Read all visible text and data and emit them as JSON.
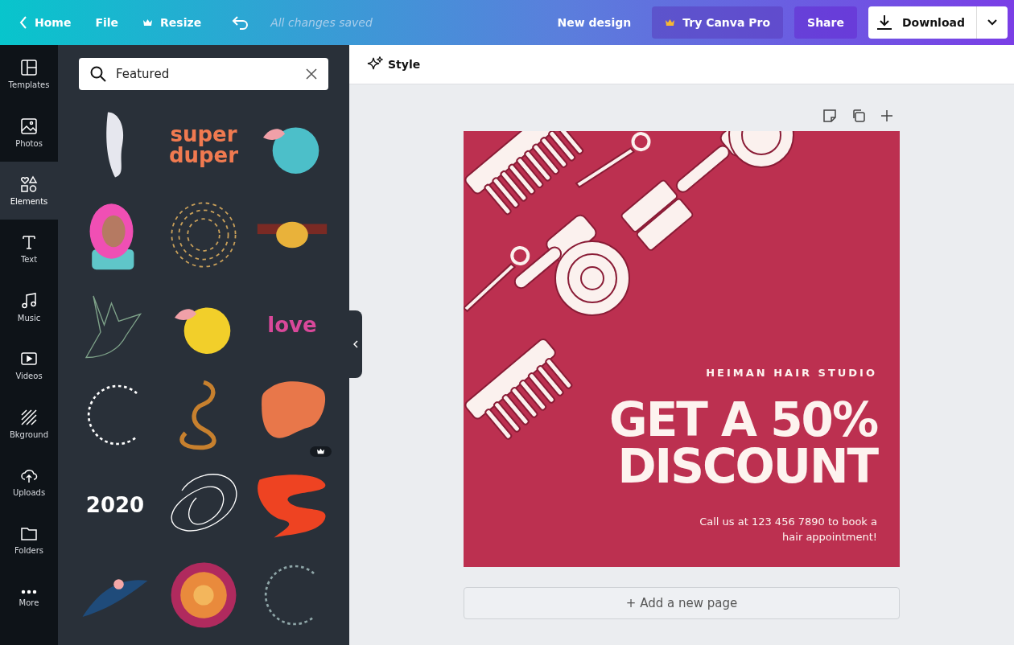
{
  "topbar": {
    "home": "Home",
    "file": "File",
    "resize": "Resize",
    "status": "All changes saved",
    "new_design": "New design",
    "try_pro": "Try Canva Pro",
    "share": "Share",
    "download": "Download"
  },
  "sidebar": {
    "items": [
      {
        "label": "Templates",
        "kind": "templates",
        "selected": false
      },
      {
        "label": "Photos",
        "kind": "photos",
        "selected": false
      },
      {
        "label": "Elements",
        "kind": "elements",
        "selected": true
      },
      {
        "label": "Text",
        "kind": "text",
        "selected": false
      },
      {
        "label": "Music",
        "kind": "music",
        "selected": false
      },
      {
        "label": "Videos",
        "kind": "videos",
        "selected": false
      },
      {
        "label": "Bkground",
        "kind": "background",
        "selected": false
      },
      {
        "label": "Uploads",
        "kind": "uploads",
        "selected": false
      },
      {
        "label": "Folders",
        "kind": "folders",
        "selected": false
      },
      {
        "label": "More",
        "kind": "more",
        "selected": false
      }
    ]
  },
  "panel": {
    "search": {
      "value": "Featured"
    },
    "elements": [
      {
        "kind": "figure",
        "color": "#e6e7ee",
        "pro": false
      },
      {
        "kind": "lettering",
        "text": "super duper",
        "color": "#f07a50",
        "pro": false
      },
      {
        "kind": "fruit",
        "color": "#4cbfc9",
        "pro": false
      },
      {
        "kind": "portrait",
        "color": "#f04fb4",
        "pro": false
      },
      {
        "kind": "sunburst",
        "color": "#c9a05a",
        "pro": false
      },
      {
        "kind": "branch",
        "color": "#e9b23a",
        "pro": false
      },
      {
        "kind": "hand",
        "color": "#7fa38a",
        "pro": false
      },
      {
        "kind": "fruit",
        "color": "#f2cf2a",
        "pro": false
      },
      {
        "kind": "lettering",
        "text": "love",
        "color": "#d9489a",
        "pro": false
      },
      {
        "kind": "wreath",
        "color": "#ffffff",
        "pro": false
      },
      {
        "kind": "snake",
        "color": "#c7802e",
        "pro": false
      },
      {
        "kind": "blob",
        "color": "#e8774a",
        "pro": true
      },
      {
        "kind": "lettering",
        "text": "2020",
        "color": "#ffffff",
        "pro": false
      },
      {
        "kind": "scribble",
        "color": "#ffffff",
        "pro": false
      },
      {
        "kind": "wave",
        "color": "#ee4322",
        "pro": false
      },
      {
        "kind": "leaves",
        "color": "#1f4b7a",
        "pro": false
      },
      {
        "kind": "mandala",
        "color": "#e98a3c",
        "pro": false
      },
      {
        "kind": "wreath",
        "color": "#8fa6a8",
        "pro": false
      }
    ]
  },
  "editor": {
    "style": "Style",
    "design": {
      "studio": "HEIMAN HAIR STUDIO",
      "headline": [
        "GET A 50%",
        "DISCOUNT"
      ],
      "body": "Call us at 123 456 7890 to book a hair appointment!"
    },
    "add_page": "+ Add a new page"
  }
}
